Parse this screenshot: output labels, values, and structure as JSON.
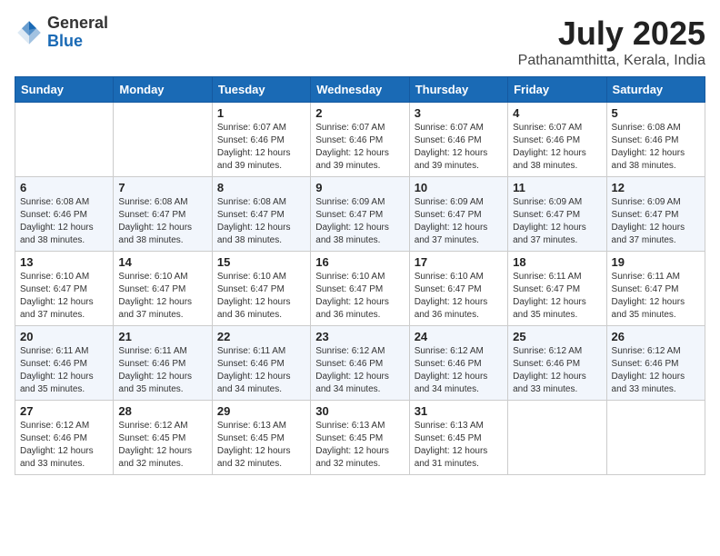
{
  "header": {
    "logo_general": "General",
    "logo_blue": "Blue",
    "month_year": "July 2025",
    "location": "Pathanamthitta, Kerala, India"
  },
  "days_of_week": [
    "Sunday",
    "Monday",
    "Tuesday",
    "Wednesday",
    "Thursday",
    "Friday",
    "Saturday"
  ],
  "weeks": [
    [
      {
        "day": "",
        "info": ""
      },
      {
        "day": "",
        "info": ""
      },
      {
        "day": "1",
        "info": "Sunrise: 6:07 AM\nSunset: 6:46 PM\nDaylight: 12 hours and 39 minutes."
      },
      {
        "day": "2",
        "info": "Sunrise: 6:07 AM\nSunset: 6:46 PM\nDaylight: 12 hours and 39 minutes."
      },
      {
        "day": "3",
        "info": "Sunrise: 6:07 AM\nSunset: 6:46 PM\nDaylight: 12 hours and 39 minutes."
      },
      {
        "day": "4",
        "info": "Sunrise: 6:07 AM\nSunset: 6:46 PM\nDaylight: 12 hours and 38 minutes."
      },
      {
        "day": "5",
        "info": "Sunrise: 6:08 AM\nSunset: 6:46 PM\nDaylight: 12 hours and 38 minutes."
      }
    ],
    [
      {
        "day": "6",
        "info": "Sunrise: 6:08 AM\nSunset: 6:46 PM\nDaylight: 12 hours and 38 minutes."
      },
      {
        "day": "7",
        "info": "Sunrise: 6:08 AM\nSunset: 6:47 PM\nDaylight: 12 hours and 38 minutes."
      },
      {
        "day": "8",
        "info": "Sunrise: 6:08 AM\nSunset: 6:47 PM\nDaylight: 12 hours and 38 minutes."
      },
      {
        "day": "9",
        "info": "Sunrise: 6:09 AM\nSunset: 6:47 PM\nDaylight: 12 hours and 38 minutes."
      },
      {
        "day": "10",
        "info": "Sunrise: 6:09 AM\nSunset: 6:47 PM\nDaylight: 12 hours and 37 minutes."
      },
      {
        "day": "11",
        "info": "Sunrise: 6:09 AM\nSunset: 6:47 PM\nDaylight: 12 hours and 37 minutes."
      },
      {
        "day": "12",
        "info": "Sunrise: 6:09 AM\nSunset: 6:47 PM\nDaylight: 12 hours and 37 minutes."
      }
    ],
    [
      {
        "day": "13",
        "info": "Sunrise: 6:10 AM\nSunset: 6:47 PM\nDaylight: 12 hours and 37 minutes."
      },
      {
        "day": "14",
        "info": "Sunrise: 6:10 AM\nSunset: 6:47 PM\nDaylight: 12 hours and 37 minutes."
      },
      {
        "day": "15",
        "info": "Sunrise: 6:10 AM\nSunset: 6:47 PM\nDaylight: 12 hours and 36 minutes."
      },
      {
        "day": "16",
        "info": "Sunrise: 6:10 AM\nSunset: 6:47 PM\nDaylight: 12 hours and 36 minutes."
      },
      {
        "day": "17",
        "info": "Sunrise: 6:10 AM\nSunset: 6:47 PM\nDaylight: 12 hours and 36 minutes."
      },
      {
        "day": "18",
        "info": "Sunrise: 6:11 AM\nSunset: 6:47 PM\nDaylight: 12 hours and 35 minutes."
      },
      {
        "day": "19",
        "info": "Sunrise: 6:11 AM\nSunset: 6:47 PM\nDaylight: 12 hours and 35 minutes."
      }
    ],
    [
      {
        "day": "20",
        "info": "Sunrise: 6:11 AM\nSunset: 6:46 PM\nDaylight: 12 hours and 35 minutes."
      },
      {
        "day": "21",
        "info": "Sunrise: 6:11 AM\nSunset: 6:46 PM\nDaylight: 12 hours and 35 minutes."
      },
      {
        "day": "22",
        "info": "Sunrise: 6:11 AM\nSunset: 6:46 PM\nDaylight: 12 hours and 34 minutes."
      },
      {
        "day": "23",
        "info": "Sunrise: 6:12 AM\nSunset: 6:46 PM\nDaylight: 12 hours and 34 minutes."
      },
      {
        "day": "24",
        "info": "Sunrise: 6:12 AM\nSunset: 6:46 PM\nDaylight: 12 hours and 34 minutes."
      },
      {
        "day": "25",
        "info": "Sunrise: 6:12 AM\nSunset: 6:46 PM\nDaylight: 12 hours and 33 minutes."
      },
      {
        "day": "26",
        "info": "Sunrise: 6:12 AM\nSunset: 6:46 PM\nDaylight: 12 hours and 33 minutes."
      }
    ],
    [
      {
        "day": "27",
        "info": "Sunrise: 6:12 AM\nSunset: 6:46 PM\nDaylight: 12 hours and 33 minutes."
      },
      {
        "day": "28",
        "info": "Sunrise: 6:12 AM\nSunset: 6:45 PM\nDaylight: 12 hours and 32 minutes."
      },
      {
        "day": "29",
        "info": "Sunrise: 6:13 AM\nSunset: 6:45 PM\nDaylight: 12 hours and 32 minutes."
      },
      {
        "day": "30",
        "info": "Sunrise: 6:13 AM\nSunset: 6:45 PM\nDaylight: 12 hours and 32 minutes."
      },
      {
        "day": "31",
        "info": "Sunrise: 6:13 AM\nSunset: 6:45 PM\nDaylight: 12 hours and 31 minutes."
      },
      {
        "day": "",
        "info": ""
      },
      {
        "day": "",
        "info": ""
      }
    ]
  ]
}
